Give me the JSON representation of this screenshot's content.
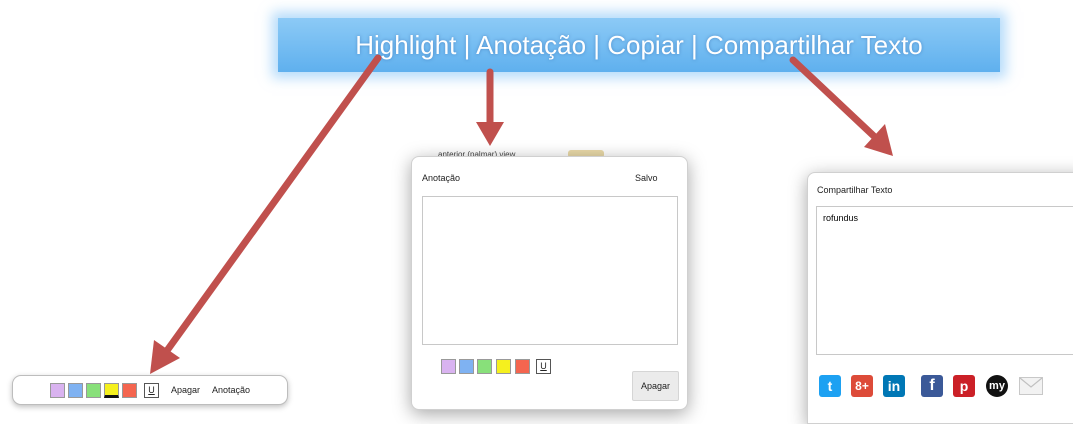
{
  "banner": {
    "text": "Highlight | Anotação | Copiar | Compartilhar Texto"
  },
  "colors": {
    "banner": "#6fbaf1",
    "arrow": "#c0504d",
    "swatch_purple": "#d9b3f0",
    "swatch_blue": "#7fb2f2",
    "swatch_green": "#88e07a",
    "swatch_yellow": "#f5f01e",
    "swatch_red": "#f4654f",
    "twitter": "#1da1f2",
    "gplus": "#dd4b39",
    "linkedin": "#0077b5",
    "facebook": "#3b5998",
    "pinterest": "#cb2027",
    "myspace": "#111111"
  },
  "toolbar": {
    "swatches": [
      "purple",
      "blue",
      "green",
      "yellow",
      "red"
    ],
    "underline_label": "U",
    "delete_label": "Apagar",
    "note_label": "Anotação"
  },
  "note_panel": {
    "title": "Anotação",
    "status": "Salvo",
    "textarea_value": "",
    "underline_label": "U",
    "delete_label": "Apagar",
    "behind_text": "anterior (palmar) view"
  },
  "share_panel": {
    "title": "Compartilhar Texto",
    "textarea_value": "rofundus",
    "icons": [
      "twitter-icon",
      "google-plus-icon",
      "linkedin-icon",
      "facebook-icon",
      "pinterest-icon",
      "myspace-icon",
      "email-icon"
    ],
    "icon_glyphs": {
      "twitter": "t",
      "gplus": "8+",
      "linkedin": "in",
      "facebook": "f",
      "pinterest": "p",
      "myspace": "my"
    }
  }
}
